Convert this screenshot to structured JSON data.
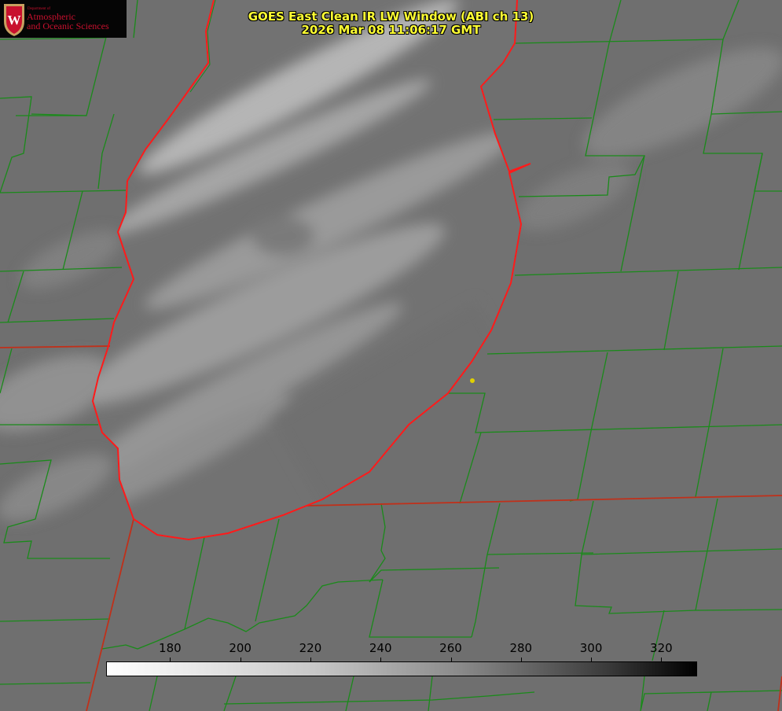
{
  "title": {
    "line1": "GOES East Clean IR LW Window (ABI ch 13)",
    "line2": "2026 Mar 08 11:06:17 GMT"
  },
  "logo": {
    "department": "Department of",
    "line1": "Atmospheric",
    "line2": "and Oceanic Sciences",
    "emblem": "W"
  },
  "colorbar": {
    "min": 162,
    "max": 330,
    "ticks": [
      "180",
      "200",
      "220",
      "240",
      "260",
      "280",
      "300",
      "320"
    ],
    "tick_values": [
      180,
      200,
      220,
      240,
      260,
      280,
      300,
      320
    ],
    "colormap": "white-to-black"
  },
  "colors": {
    "county_lines": "#1a8a1a",
    "shoreline": "#ff1a1a",
    "title": "#ffff33",
    "marker": "#e0d000"
  }
}
